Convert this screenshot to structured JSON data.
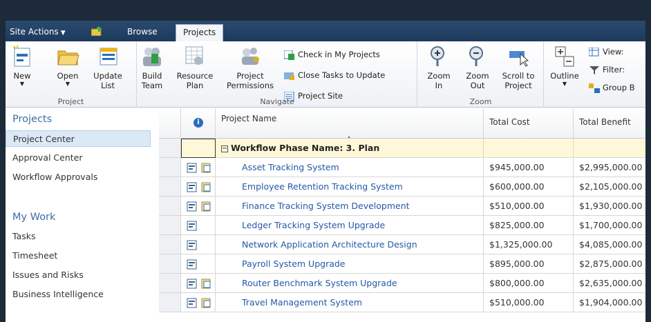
{
  "tabs": {
    "site_actions": "Site Actions",
    "browse": "Browse",
    "projects": "Projects"
  },
  "ribbon": {
    "project_group": {
      "label": "Project",
      "new": "New",
      "open": "Open",
      "update_list_1": "Update",
      "update_list_2": "List"
    },
    "navigate_group": {
      "label": "Navigate",
      "build_team_1": "Build",
      "build_team_2": "Team",
      "resource_plan_1": "Resource",
      "resource_plan_2": "Plan",
      "project_permissions_1": "Project",
      "project_permissions_2": "Permissions",
      "check_in": "Check in My Projects",
      "close_tasks": "Close Tasks to Update",
      "project_site": "Project Site"
    },
    "zoom_group": {
      "label": "Zoom",
      "zoom_in_1": "Zoom",
      "zoom_in_2": "In",
      "zoom_out_1": "Zoom",
      "zoom_out_2": "Out",
      "scroll_1": "Scroll to",
      "scroll_2": "Project"
    },
    "data_group": {
      "outline": "Outline",
      "view": "View:",
      "filter": "Filter:",
      "group_by": "Group B"
    }
  },
  "leftnav": {
    "projects_heading": "Projects",
    "items": [
      "Project Center",
      "Approval Center",
      "Workflow Approvals"
    ],
    "mywork_heading": "My Work",
    "work_items": [
      "Tasks",
      "Timesheet",
      "Issues and Risks",
      "Business Intelligence"
    ]
  },
  "grid": {
    "columns": {
      "info": "i",
      "name": "Project Name",
      "cost": "Total Cost",
      "benefit": "Total Benefit"
    },
    "phase": "Workflow Phase Name: 3. Plan",
    "rows": [
      {
        "name": "Asset Tracking System",
        "cost": "$945,000.00",
        "benefit": "$2,995,000.00"
      },
      {
        "name": "Employee Retention Tracking System",
        "cost": "$600,000.00",
        "benefit": "$2,105,000.00"
      },
      {
        "name": "Finance Tracking System Development",
        "cost": "$510,000.00",
        "benefit": "$1,930,000.00"
      },
      {
        "name": "Ledger Tracking System Upgrade",
        "cost": "$825,000.00",
        "benefit": "$1,700,000.00"
      },
      {
        "name": "Network Application Architecture Design",
        "cost": "$1,325,000.00",
        "benefit": "$4,085,000.00"
      },
      {
        "name": "Payroll System Upgrade",
        "cost": "$895,000.00",
        "benefit": "$2,875,000.00"
      },
      {
        "name": "Router Benchmark System Upgrade",
        "cost": "$800,000.00",
        "benefit": "$2,635,000.00"
      },
      {
        "name": "Travel Management System",
        "cost": "$510,000.00",
        "benefit": "$1,904,000.00"
      }
    ]
  }
}
